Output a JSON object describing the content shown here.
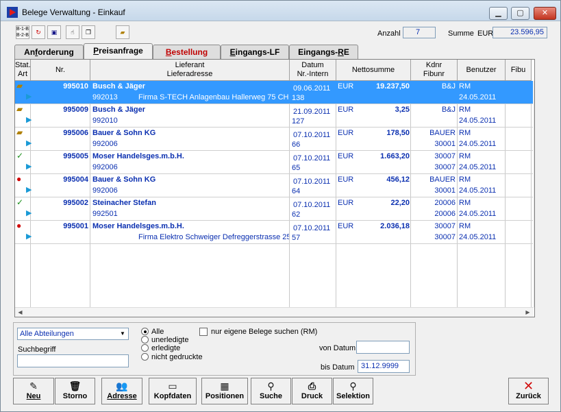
{
  "window": {
    "title": "Belege Verwaltung - Einkauf"
  },
  "summary": {
    "anzahl_label": "Anzahl",
    "anzahl_value": "7",
    "summe_label": "Summe",
    "currency": "EUR",
    "summe_value": "23.596,95"
  },
  "tabs": [
    {
      "label": "Anforderung",
      "underline": "f",
      "pre": "An",
      "post": "orderung"
    },
    {
      "label": "Preisanfrage",
      "pre": "",
      "underline": "P",
      "post": "reisanfrage"
    },
    {
      "label": "Bestellung",
      "pre": "",
      "underline": "B",
      "post": "estellung"
    },
    {
      "label": "Eingangs-LF",
      "pre": "",
      "underline": "E",
      "post": "ingangs-LF"
    },
    {
      "label": "Eingangs-RE",
      "pre": "Eingangs-",
      "underline": "R",
      "post": "E"
    }
  ],
  "table": {
    "headers": {
      "stat": "Stat.",
      "art": "Art",
      "nr": "Nr.",
      "lieferant": "Lieferant",
      "lieferadresse": "Lieferadresse",
      "datum": "Datum",
      "nr_intern": "Nr.-Intern",
      "netto": "Nettosumme",
      "kdnr": "Kdnr",
      "fibunr": "Fibunr",
      "benutzer": "Benutzer",
      "fibu": "Fibu"
    },
    "rows": [
      {
        "nr": "995010",
        "lieferant": "Busch & Jäger",
        "kdnr": "992013",
        "adresse": "Firma  S-TECH Anlagenbau  Hallerweg 75  CH",
        "datum": "09.06.2011",
        "intern": "138",
        "waehrung": "EUR",
        "netto": "19.237,50",
        "kd1": "B&J",
        "kd2": "",
        "user": "RM",
        "udate": "24.05.2011",
        "status": "folder-open-icon",
        "selected": true
      },
      {
        "nr": "995009",
        "lieferant": "Busch & Jäger",
        "kdnr": "992010",
        "adresse": "",
        "datum": "21.09.2011",
        "intern": "127",
        "waehrung": "EUR",
        "netto": "3,25",
        "kd1": "B&J",
        "kd2": "",
        "user": "RM",
        "udate": "24.05.2011",
        "status": "folder-open-icon",
        "selected": false
      },
      {
        "nr": "995006",
        "lieferant": "Bauer & Sohn KG",
        "kdnr": "992006",
        "adresse": "",
        "datum": "07.10.2011",
        "intern": "66",
        "waehrung": "EUR",
        "netto": "178,50",
        "kd1": "BAUER",
        "kd2": "30001",
        "user": "RM",
        "udate": "24.05.2011",
        "status": "folder-open-icon",
        "selected": false
      },
      {
        "nr": "995005",
        "lieferant": "Moser Handelsges.m.b.H.",
        "kdnr": "992006",
        "adresse": "",
        "datum": "07.10.2011",
        "intern": "65",
        "waehrung": "EUR",
        "netto": "1.663,20",
        "kd1": "30007",
        "kd2": "30007",
        "user": "RM",
        "udate": "24.05.2011",
        "status": "check-icon",
        "selected": false
      },
      {
        "nr": "995004",
        "lieferant": "Bauer & Sohn KG",
        "kdnr": "992006",
        "adresse": "",
        "datum": "07.10.2011",
        "intern": "64",
        "waehrung": "EUR",
        "netto": "456,12",
        "kd1": "BAUER",
        "kd2": "30001",
        "user": "RM",
        "udate": "24.05.2011",
        "status": "red-dot-icon",
        "selected": false
      },
      {
        "nr": "995002",
        "lieferant": "Steinacher Stefan",
        "kdnr": "992501",
        "adresse": "",
        "datum": "07.10.2011",
        "intern": "62",
        "waehrung": "EUR",
        "netto": "22,20",
        "kd1": "20006",
        "kd2": "20006",
        "user": "RM",
        "udate": "24.05.2011",
        "status": "check-icon",
        "selected": false
      },
      {
        "nr": "995001",
        "lieferant": "Moser Handelsges.m.b.H.",
        "kdnr": "",
        "adresse": "Firma Elektro Schweiger Defreggerstrasse 25",
        "datum": "07.10.2011",
        "intern": "57",
        "waehrung": "EUR",
        "netto": "2.036,18",
        "kd1": "30007",
        "kd2": "30007",
        "user": "RM",
        "udate": "24.05.2011",
        "status": "red-dot-icon",
        "selected": false
      }
    ]
  },
  "filter": {
    "abteilung": "Alle Abteilungen",
    "suchbegriff_label": "Suchbegriff",
    "radios": [
      "Alle",
      "unerledigte",
      "erledigte",
      "nicht gedruckte"
    ],
    "own_only_label": "nur eigene Belege suchen (RM)",
    "von_label": "von Datum",
    "von_value": "",
    "bis_label": "bis Datum",
    "bis_value": "31.12.9999"
  },
  "buttons": [
    {
      "label": "Neu",
      "icon": "pencil-icon",
      "glyph": "✎"
    },
    {
      "label": "Storno",
      "icon": "trash-icon",
      "glyph": "🗑"
    },
    {
      "label": "Adresse",
      "icon": "people-icon",
      "glyph": "👥"
    },
    {
      "label": "Kopfdaten",
      "icon": "header-icon",
      "glyph": "▭"
    },
    {
      "label": "Positionen",
      "icon": "table-icon",
      "glyph": "▦"
    },
    {
      "label": "Suche",
      "icon": "binoculars-icon",
      "glyph": "⚲"
    },
    {
      "label": "Druck",
      "icon": "printer-icon",
      "glyph": "⎙"
    },
    {
      "label": "Selektion",
      "icon": "binoculars-select-icon",
      "glyph": "⚲"
    },
    {
      "label": "Zurück",
      "icon": "close-x-icon",
      "glyph": "✕"
    }
  ],
  "colors": {
    "selection": "#3399ff",
    "text_blue": "#0a2fb0",
    "tab_red": "#c00000"
  }
}
